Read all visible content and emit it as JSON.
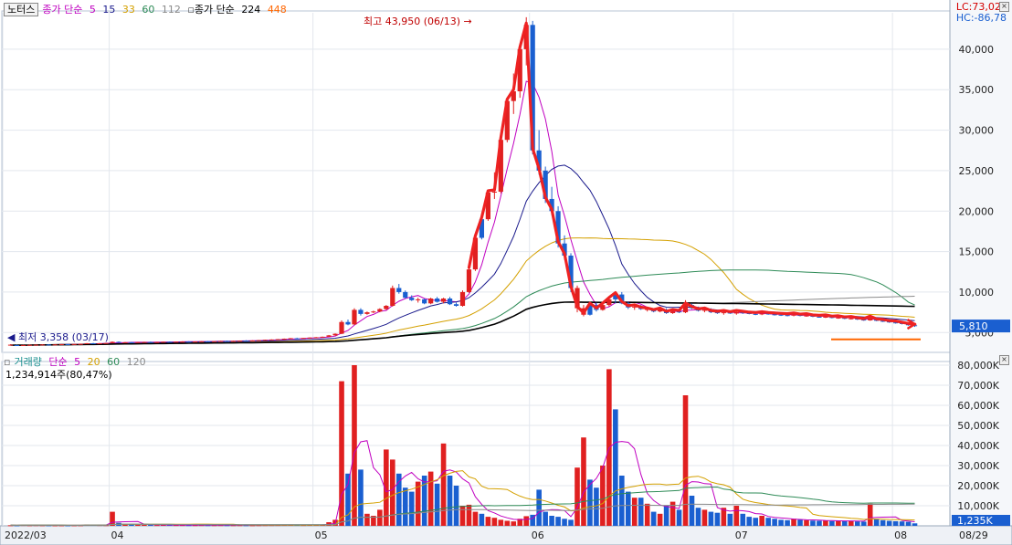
{
  "price_legend": {
    "box_label": "노터스",
    "ma_label": "종가 단순",
    "periods": [
      "5",
      "15",
      "33",
      "60",
      "112"
    ],
    "ma_label2": "종가 단순",
    "periods2": [
      "224",
      "448"
    ],
    "colors": [
      "#c000c0",
      "#1a1a8c",
      "#d4a000",
      "#2e8b57",
      "#8b8b8b",
      "#000000",
      "#ff6600"
    ]
  },
  "indicators": {
    "lc": "LC:73,02",
    "hc": "HC:-86,78"
  },
  "volume_legend": {
    "box_label": "거래량",
    "ma_label": "단순",
    "periods": [
      "5",
      "20",
      "60",
      "120"
    ],
    "colors": [
      "#c000c0",
      "#d4a000",
      "#2e8b57",
      "#8b8b8b"
    ],
    "info": "1,234,914주(80,47%)"
  },
  "chart_data": {
    "type": "candlestick",
    "title": "노터스",
    "price_axis": {
      "ticks": [
        "40,000",
        "35,000",
        "30,000",
        "25,000",
        "20,000",
        "15,000",
        "10,000",
        "5,000"
      ],
      "range": [
        3000,
        44500
      ]
    },
    "current_price": "5,810",
    "annotations": {
      "high": "최고 43,950 (06/13)",
      "low": "최저 3,358 (03/17)"
    },
    "volume_axis": {
      "ticks": [
        "80,000K",
        "70,000K",
        "60,000K",
        "50,000K",
        "40,000K",
        "30,000K",
        "20,000K",
        "10,000K"
      ],
      "range": [
        0,
        80000
      ]
    },
    "current_volume": "1,235K",
    "x_labels": [
      "2022/03",
      "04",
      "05",
      "06",
      "07",
      "08",
      "08/29"
    ],
    "candles": [
      [
        3500,
        3550,
        3400,
        3450,
        300,
        0
      ],
      [
        3450,
        3500,
        3380,
        3420,
        250,
        1
      ],
      [
        3420,
        3480,
        3358,
        3460,
        400,
        0
      ],
      [
        3460,
        3520,
        3420,
        3480,
        300,
        0
      ],
      [
        3480,
        3540,
        3440,
        3500,
        350,
        0
      ],
      [
        3500,
        3560,
        3470,
        3520,
        300,
        0
      ],
      [
        3520,
        3560,
        3480,
        3500,
        280,
        1
      ],
      [
        3500,
        3550,
        3460,
        3530,
        250,
        0
      ],
      [
        3530,
        3580,
        3500,
        3560,
        260,
        0
      ],
      [
        3560,
        3600,
        3510,
        3540,
        240,
        1
      ],
      [
        3540,
        3600,
        3500,
        3580,
        270,
        0
      ],
      [
        3580,
        3640,
        3540,
        3600,
        300,
        0
      ],
      [
        3600,
        3700,
        3580,
        3680,
        600,
        0
      ],
      [
        3680,
        3720,
        3620,
        3650,
        500,
        1
      ],
      [
        3650,
        3700,
        3600,
        3670,
        400,
        0
      ],
      [
        3670,
        3720,
        3630,
        3700,
        350,
        0
      ],
      [
        3700,
        3900,
        3680,
        3850,
        7000,
        0
      ],
      [
        3850,
        3900,
        3750,
        3780,
        1500,
        1
      ],
      [
        3780,
        3830,
        3720,
        3800,
        900,
        0
      ],
      [
        3800,
        3850,
        3750,
        3790,
        700,
        1
      ],
      [
        3790,
        3830,
        3740,
        3810,
        600,
        0
      ],
      [
        3810,
        3860,
        3770,
        3830,
        500,
        0
      ],
      [
        3830,
        3880,
        3790,
        3800,
        450,
        1
      ],
      [
        3800,
        3850,
        3760,
        3820,
        400,
        0
      ],
      [
        3820,
        3880,
        3800,
        3860,
        500,
        0
      ],
      [
        3860,
        3900,
        3810,
        3840,
        450,
        1
      ],
      [
        3840,
        3890,
        3800,
        3870,
        400,
        0
      ],
      [
        3870,
        3920,
        3830,
        3880,
        400,
        0
      ],
      [
        3880,
        3920,
        3840,
        3870,
        350,
        1
      ],
      [
        3870,
        3910,
        3830,
        3890,
        350,
        0
      ],
      [
        3890,
        3940,
        3860,
        3920,
        380,
        0
      ],
      [
        3920,
        3960,
        3880,
        3900,
        340,
        1
      ],
      [
        3900,
        3950,
        3870,
        3930,
        330,
        0
      ],
      [
        3930,
        3980,
        3900,
        3960,
        360,
        0
      ],
      [
        3960,
        4000,
        3920,
        3940,
        330,
        1
      ],
      [
        3940,
        3990,
        3910,
        3970,
        320,
        0
      ],
      [
        3970,
        4020,
        3940,
        4000,
        340,
        0
      ],
      [
        4000,
        4050,
        3960,
        3990,
        310,
        1
      ],
      [
        3990,
        4040,
        3960,
        4020,
        300,
        0
      ],
      [
        4020,
        4080,
        3990,
        4060,
        350,
        0
      ],
      [
        4060,
        4120,
        4030,
        4100,
        380,
        0
      ],
      [
        4100,
        4160,
        4070,
        4140,
        400,
        0
      ],
      [
        4140,
        4200,
        4100,
        4180,
        420,
        0
      ],
      [
        4180,
        4260,
        4150,
        4240,
        450,
        0
      ],
      [
        4240,
        4320,
        4200,
        4300,
        500,
        0
      ],
      [
        4300,
        4360,
        4260,
        4280,
        450,
        1
      ],
      [
        4280,
        4340,
        4240,
        4330,
        420,
        0
      ],
      [
        4330,
        4400,
        4300,
        4380,
        450,
        0
      ],
      [
        4380,
        4450,
        4340,
        4420,
        480,
        0
      ],
      [
        4420,
        4500,
        4400,
        4480,
        600,
        0
      ],
      [
        4480,
        4700,
        4460,
        4650,
        1800,
        0
      ],
      [
        4650,
        4900,
        4600,
        4850,
        3000,
        0
      ],
      [
        4850,
        6500,
        4800,
        6300,
        72000,
        0
      ],
      [
        6300,
        6600,
        5900,
        6000,
        26000,
        1
      ],
      [
        6000,
        8000,
        5950,
        7800,
        80000,
        0
      ],
      [
        7800,
        8000,
        7100,
        7300,
        28000,
        1
      ],
      [
        7300,
        7600,
        7200,
        7500,
        6000,
        0
      ],
      [
        7500,
        7700,
        7400,
        7600,
        5000,
        0
      ],
      [
        7600,
        8000,
        7500,
        7900,
        8000,
        0
      ],
      [
        7900,
        8400,
        7800,
        8300,
        38000,
        0
      ],
      [
        8300,
        10800,
        8200,
        10500,
        33000,
        0
      ],
      [
        10500,
        11000,
        9800,
        10000,
        26000,
        1
      ],
      [
        10000,
        10200,
        9200,
        9300,
        19000,
        1
      ],
      [
        9300,
        9600,
        8900,
        9000,
        17000,
        1
      ],
      [
        9000,
        9300,
        8700,
        9100,
        22000,
        0
      ],
      [
        9100,
        9200,
        8500,
        8600,
        25000,
        1
      ],
      [
        8600,
        9300,
        8500,
        9200,
        27000,
        0
      ],
      [
        9200,
        9400,
        8700,
        8800,
        21000,
        1
      ],
      [
        8800,
        9300,
        8600,
        9200,
        41000,
        0
      ],
      [
        9200,
        9400,
        8400,
        8500,
        25000,
        1
      ],
      [
        8500,
        8700,
        8200,
        8300,
        20000,
        1
      ],
      [
        8300,
        10200,
        8200,
        10000,
        10000,
        0
      ],
      [
        10000,
        13000,
        9900,
        12800,
        10500,
        0
      ],
      [
        12800,
        17000,
        12600,
        16700,
        7000,
        0
      ],
      [
        16700,
        19500,
        16500,
        19000,
        6000,
        1
      ],
      [
        19000,
        22500,
        18800,
        22300,
        4500,
        0
      ],
      [
        22300,
        24800,
        21500,
        22400,
        4000,
        0
      ],
      [
        22400,
        29000,
        22200,
        28800,
        3000,
        0
      ],
      [
        28800,
        34000,
        28500,
        33600,
        2500,
        0
      ],
      [
        33600,
        37000,
        32000,
        34800,
        2200,
        0
      ],
      [
        34800,
        40500,
        34000,
        40000,
        3500,
        0
      ],
      [
        40000,
        43950,
        38000,
        43000,
        4800,
        0
      ],
      [
        43000,
        43500,
        27000,
        27500,
        5500,
        1
      ],
      [
        27500,
        30000,
        24500,
        25000,
        18000,
        1
      ],
      [
        25000,
        25500,
        21000,
        21500,
        7000,
        1
      ],
      [
        21500,
        23000,
        19500,
        20000,
        5000,
        1
      ],
      [
        20000,
        20600,
        15500,
        16000,
        4500,
        1
      ],
      [
        16000,
        17000,
        14000,
        14500,
        3500,
        1
      ],
      [
        14500,
        14800,
        10000,
        10500,
        3000,
        1
      ],
      [
        10500,
        10800,
        7500,
        8000,
        29000,
        0
      ],
      [
        8000,
        8400,
        7000,
        7200,
        44000,
        0
      ],
      [
        7200,
        8600,
        7100,
        8400,
        23000,
        1
      ],
      [
        8400,
        8700,
        7600,
        7800,
        19000,
        1
      ],
      [
        7800,
        8500,
        7700,
        8400,
        30000,
        0
      ],
      [
        8400,
        9300,
        8200,
        9100,
        78000,
        0
      ],
      [
        9100,
        9900,
        8600,
        9700,
        58000,
        1
      ],
      [
        9700,
        10000,
        8500,
        8600,
        25000,
        1
      ],
      [
        8600,
        8800,
        7900,
        8100,
        17000,
        1
      ],
      [
        8100,
        8400,
        7800,
        8200,
        14000,
        0
      ],
      [
        8200,
        8400,
        7800,
        7900,
        14000,
        1
      ],
      [
        7900,
        8100,
        7600,
        7800,
        11000,
        0
      ],
      [
        7800,
        8000,
        7500,
        7600,
        7000,
        1
      ],
      [
        7600,
        7900,
        7500,
        7800,
        6000,
        0
      ],
      [
        7800,
        8000,
        7300,
        7400,
        10000,
        1
      ],
      [
        7400,
        7700,
        7300,
        7600,
        12000,
        0
      ],
      [
        7600,
        7800,
        7400,
        7500,
        8000,
        1
      ],
      [
        7500,
        9000,
        7400,
        8400,
        65000,
        0
      ],
      [
        8400,
        8600,
        7900,
        8000,
        15000,
        1
      ],
      [
        8000,
        8200,
        7600,
        7700,
        9000,
        1
      ],
      [
        7700,
        7900,
        7500,
        7800,
        8000,
        0
      ],
      [
        7800,
        8000,
        7400,
        7500,
        7000,
        1
      ],
      [
        7500,
        7700,
        7300,
        7400,
        6500,
        1
      ],
      [
        7400,
        7600,
        7200,
        7500,
        9000,
        0
      ],
      [
        7500,
        7700,
        7300,
        7350,
        6000,
        1
      ],
      [
        7350,
        7600,
        7200,
        7500,
        10000,
        0
      ],
      [
        7500,
        7700,
        7300,
        7400,
        6000,
        1
      ],
      [
        7400,
        7600,
        7250,
        7300,
        4500,
        1
      ],
      [
        7300,
        7500,
        7150,
        7250,
        4000,
        1
      ],
      [
        7250,
        7450,
        7150,
        7350,
        5000,
        0
      ],
      [
        7350,
        7500,
        7200,
        7250,
        4000,
        1
      ],
      [
        7250,
        7400,
        7100,
        7200,
        3500,
        1
      ],
      [
        7200,
        7350,
        7050,
        7150,
        3000,
        1
      ],
      [
        7150,
        7300,
        7000,
        7100,
        2800,
        1
      ],
      [
        7100,
        7250,
        7000,
        7200,
        3500,
        0
      ],
      [
        7200,
        7300,
        7000,
        7050,
        3000,
        1
      ],
      [
        7050,
        7200,
        6950,
        7100,
        2800,
        0
      ],
      [
        7100,
        7200,
        6900,
        6950,
        2600,
        1
      ],
      [
        6950,
        7100,
        6850,
        6900,
        2500,
        1
      ],
      [
        6900,
        7050,
        6800,
        6950,
        2600,
        0
      ],
      [
        6950,
        7000,
        6750,
        6800,
        2400,
        1
      ],
      [
        6800,
        6950,
        6700,
        6850,
        2500,
        0
      ],
      [
        6850,
        6950,
        6650,
        6700,
        2300,
        1
      ],
      [
        6700,
        6850,
        6600,
        6750,
        2400,
        0
      ],
      [
        6750,
        6850,
        6550,
        6600,
        2200,
        1
      ],
      [
        6600,
        6700,
        6450,
        6500,
        2100,
        1
      ],
      [
        6500,
        7100,
        6450,
        6800,
        11000,
        0
      ],
      [
        6800,
        6900,
        6400,
        6450,
        3500,
        1
      ],
      [
        6450,
        6600,
        6300,
        6400,
        2800,
        1
      ],
      [
        6400,
        6500,
        6200,
        6250,
        2500,
        1
      ],
      [
        6250,
        6400,
        6100,
        6200,
        2300,
        1
      ],
      [
        6200,
        6300,
        6000,
        6050,
        2200,
        1
      ],
      [
        6050,
        6150,
        5850,
        5900,
        2000,
        1
      ],
      [
        5900,
        6000,
        5700,
        5810,
        1235,
        1
      ]
    ]
  }
}
